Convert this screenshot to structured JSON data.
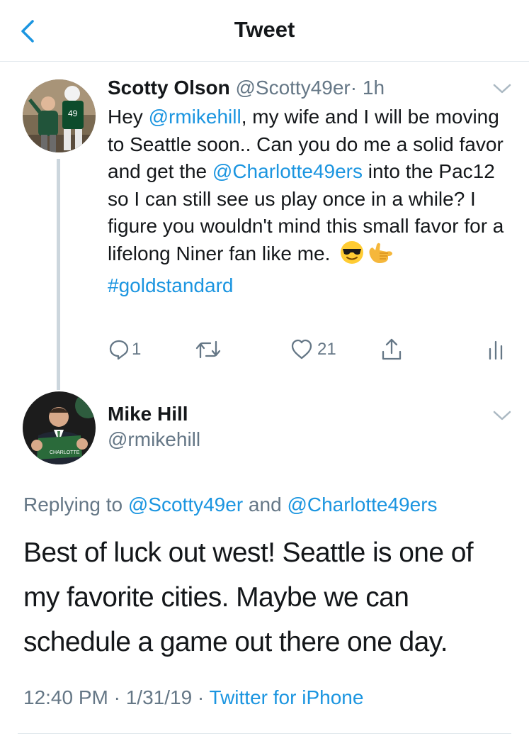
{
  "header": {
    "title": "Tweet",
    "back_icon": "chevron-left-icon",
    "accent": "#1b95e0"
  },
  "tweet1": {
    "name": "Scotty Olson",
    "handle": "@Scotty49er",
    "time": "· 1h",
    "text_parts": [
      "Hey ",
      "@rmikehill",
      ", my wife and I will be moving to Seattle soon.. Can you do me a solid favor and get the ",
      "@Charlotte49ers",
      " into the Pac12 so I can still see us play once in a while? I figure you wouldn't mind this small favor for a lifelong Niner fan like me."
    ],
    "hashtag": "#goldstandard",
    "emojis": [
      "sunglasses-face-icon",
      "call-me-hand-icon"
    ],
    "actions": {
      "replies": "1",
      "likes": "21"
    }
  },
  "tweet2": {
    "name": "Mike Hill",
    "handle": "@rmikehill",
    "replying_prefix": "Replying to ",
    "replying_user1": "@Scotty49er",
    "replying_and": " and ",
    "replying_user2": "@Charlotte49ers",
    "text": "Best of luck out west! Seattle is one of my favorite cities. Maybe we can schedule a game out there one day.",
    "timestamp": "12:40 PM · 1/31/19 · ",
    "source": "Twitter for iPhone"
  }
}
